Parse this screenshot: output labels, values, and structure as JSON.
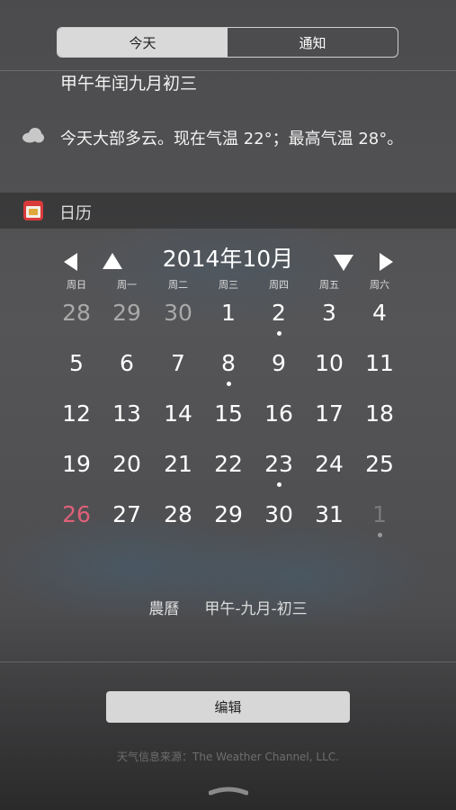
{
  "tabs": [
    {
      "label": "今天",
      "active": true
    },
    {
      "label": "通知",
      "active": false
    }
  ],
  "lunar_date": "甲午年闰九月初三",
  "weather": {
    "icon": "cloud-icon",
    "text": "今天大部多云。现在气温 22°；最高气温 28°。"
  },
  "calendar": {
    "section_title": "日历",
    "month_title": "2014年10月",
    "weekdays": [
      "周日",
      "周一",
      "周二",
      "周三",
      "周四",
      "周五",
      "周六"
    ],
    "weeks": [
      [
        {
          "d": "28",
          "s": "dim"
        },
        {
          "d": "29",
          "s": "dim"
        },
        {
          "d": "30",
          "s": "dim"
        },
        {
          "d": "1"
        },
        {
          "d": "2",
          "dot": true
        },
        {
          "d": "3"
        },
        {
          "d": "4"
        }
      ],
      [
        {
          "d": "5"
        },
        {
          "d": "6"
        },
        {
          "d": "7"
        },
        {
          "d": "8",
          "dot": true
        },
        {
          "d": "9"
        },
        {
          "d": "10"
        },
        {
          "d": "11"
        }
      ],
      [
        {
          "d": "12"
        },
        {
          "d": "13"
        },
        {
          "d": "14"
        },
        {
          "d": "15"
        },
        {
          "d": "16"
        },
        {
          "d": "17"
        },
        {
          "d": "18"
        }
      ],
      [
        {
          "d": "19"
        },
        {
          "d": "20"
        },
        {
          "d": "21"
        },
        {
          "d": "22"
        },
        {
          "d": "23",
          "dot": true
        },
        {
          "d": "24"
        },
        {
          "d": "25"
        }
      ],
      [
        {
          "d": "26",
          "s": "red"
        },
        {
          "d": "27"
        },
        {
          "d": "28"
        },
        {
          "d": "29"
        },
        {
          "d": "30"
        },
        {
          "d": "31"
        },
        {
          "d": "1",
          "s": "dim2",
          "dot": true
        }
      ]
    ],
    "lunar_label": "農曆",
    "lunar_value": "甲午-九月-初三",
    "today_color": "#e0607a"
  },
  "edit_label": "编辑",
  "source_text": "天气信息来源：The Weather Channel, LLC."
}
